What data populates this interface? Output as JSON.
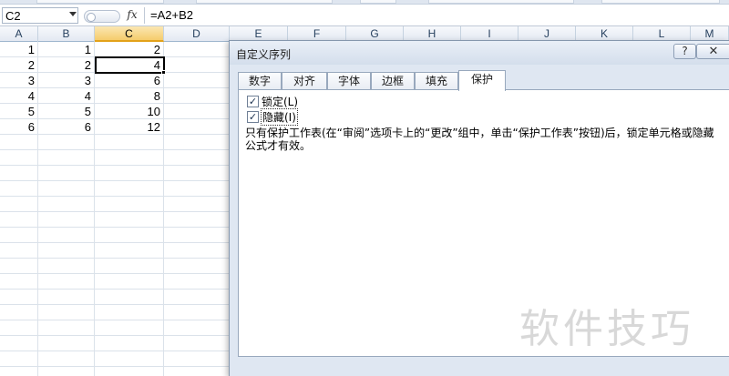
{
  "formula_bar": {
    "name_box": "C2",
    "fx_label": "fx",
    "formula": "=A2+B2"
  },
  "columns": [
    "A",
    "B",
    "C",
    "D",
    "E",
    "F",
    "G",
    "H",
    "I",
    "J",
    "K",
    "L",
    "M"
  ],
  "active_column": "C",
  "rows": [
    [
      "1",
      "1",
      "2"
    ],
    [
      "2",
      "2",
      "4"
    ],
    [
      "3",
      "3",
      "6"
    ],
    [
      "4",
      "4",
      "8"
    ],
    [
      "5",
      "5",
      "10"
    ],
    [
      "6",
      "6",
      "12"
    ]
  ],
  "dialog": {
    "title": "自定义序列",
    "help_label": "?",
    "close_label": "✕",
    "tabs": [
      {
        "label": "数字"
      },
      {
        "label": "对齐"
      },
      {
        "label": "字体"
      },
      {
        "label": "边框"
      },
      {
        "label": "填充"
      },
      {
        "label": "保护"
      }
    ],
    "active_tab": "保护",
    "locked": {
      "label": "锁定(L)",
      "checked": true
    },
    "hidden": {
      "label": "隐藏(I)",
      "checked": true
    },
    "note": "只有保护工作表(在“审阅”选项卡上的“更改”组中，单击“保护工作表”按钮)后，锁定单元格或隐藏公式才有效。"
  },
  "watermark": "软件技巧",
  "colors": {
    "dialog_bg": "#dfe7f2",
    "active_header": "#f5cc6c",
    "grid_line": "#dbe2ea"
  }
}
